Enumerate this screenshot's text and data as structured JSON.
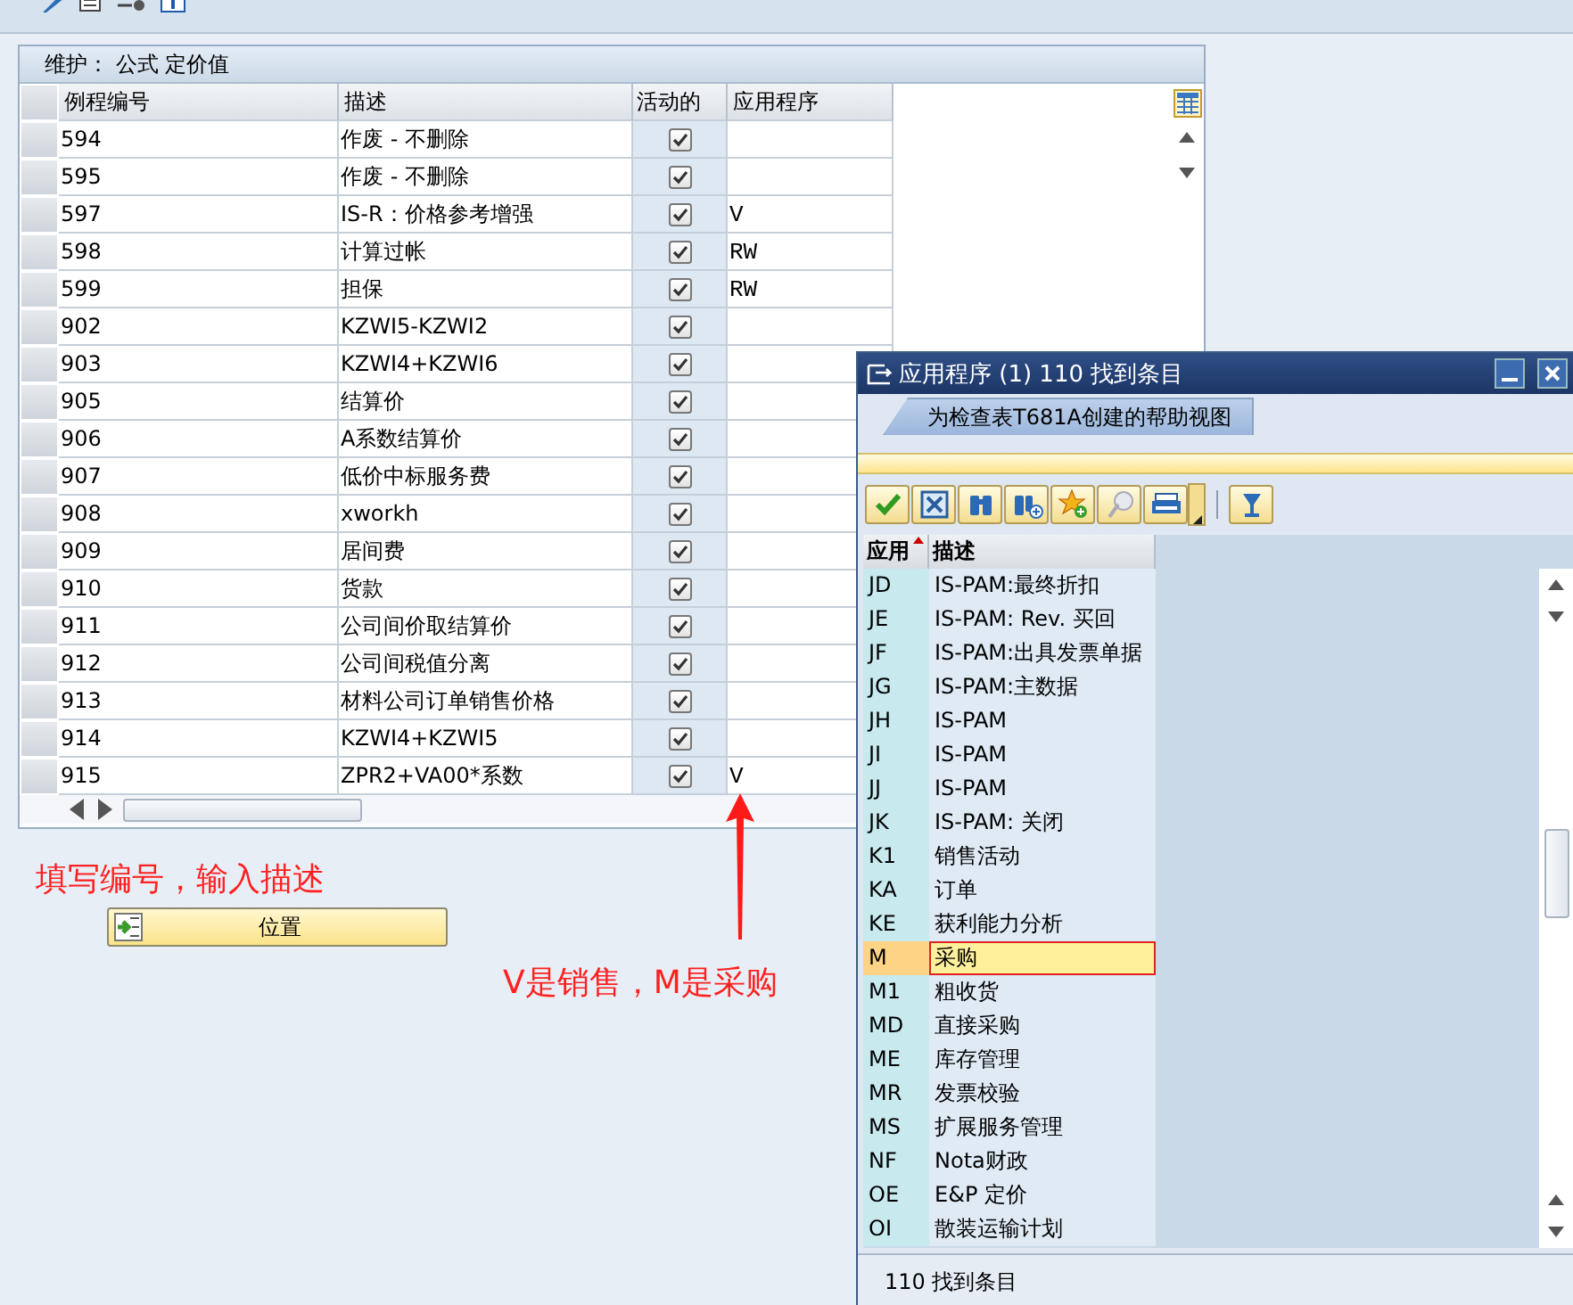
{
  "panel": {
    "title": "维护： 公式 定价值",
    "columns": [
      "例程编号",
      "描述",
      "活动的",
      "应用程序"
    ],
    "rows": [
      {
        "number": "594",
        "description": "作废 - 不删除",
        "active": true,
        "application": ""
      },
      {
        "number": "595",
        "description": "作废 - 不删除",
        "active": true,
        "application": ""
      },
      {
        "number": "597",
        "description": "IS-R：价格参考增强",
        "active": true,
        "application": "V"
      },
      {
        "number": "598",
        "description": "计算过帐",
        "active": true,
        "application": "RW"
      },
      {
        "number": "599",
        "description": "担保",
        "active": true,
        "application": "RW"
      },
      {
        "number": "902",
        "description": "KZWI5-KZWI2",
        "active": true,
        "application": ""
      },
      {
        "number": "903",
        "description": "KZWI4+KZWI6",
        "active": true,
        "application": ""
      },
      {
        "number": "905",
        "description": "结算价",
        "active": true,
        "application": ""
      },
      {
        "number": "906",
        "description": "A系数结算价",
        "active": true,
        "application": ""
      },
      {
        "number": "907",
        "description": "低价中标服务费",
        "active": true,
        "application": ""
      },
      {
        "number": "908",
        "description": "xworkh",
        "active": true,
        "application": ""
      },
      {
        "number": "909",
        "description": "居间费",
        "active": true,
        "application": ""
      },
      {
        "number": "910",
        "description": "货款",
        "active": true,
        "application": ""
      },
      {
        "number": "911",
        "description": "公司间价取结算价",
        "active": true,
        "application": ""
      },
      {
        "number": "912",
        "description": "公司间税值分离",
        "active": true,
        "application": ""
      },
      {
        "number": "913",
        "description": "材料公司订单销售价格",
        "active": true,
        "application": ""
      },
      {
        "number": "914",
        "description": "KZWI4+KZWI5",
        "active": true,
        "application": ""
      },
      {
        "number": "915",
        "description": "ZPR2+VA00*系数",
        "active": true,
        "application": "V"
      }
    ]
  },
  "position_button": "位置",
  "annotations": [
    "填写编号，输入描述",
    "V是销售，M是采购"
  ],
  "popup": {
    "title": "应用程序 (1) 110 找到条目",
    "tab": {
      "label": "为检查表T681A创建的帮助视图",
      "selected": true
    },
    "columns": [
      "应用",
      "描述"
    ],
    "rows": [
      {
        "code": "JD",
        "description": "IS-PAM:最终折扣",
        "selected": false
      },
      {
        "code": "JE",
        "description": "IS-PAM: Rev. 买回",
        "selected": false
      },
      {
        "code": "JF",
        "description": "IS-PAM:出具发票单据",
        "selected": false
      },
      {
        "code": "JG",
        "description": "IS-PAM:主数据",
        "selected": false
      },
      {
        "code": "JH",
        "description": "IS-PAM",
        "selected": false
      },
      {
        "code": "JI",
        "description": "IS-PAM",
        "selected": false
      },
      {
        "code": "JJ",
        "description": "IS-PAM",
        "selected": false
      },
      {
        "code": "JK",
        "description": "IS-PAM: 关闭",
        "selected": false
      },
      {
        "code": "K1",
        "description": "销售活动",
        "selected": false
      },
      {
        "code": "KA",
        "description": "订单",
        "selected": false
      },
      {
        "code": "KE",
        "description": "获利能力分析",
        "selected": false
      },
      {
        "code": "M",
        "description": "采购",
        "selected": true
      },
      {
        "code": "M1",
        "description": "粗收货",
        "selected": false
      },
      {
        "code": "MD",
        "description": "直接采购",
        "selected": false
      },
      {
        "code": "ME",
        "description": "库存管理",
        "selected": false
      },
      {
        "code": "MR",
        "description": "发票校验",
        "selected": false
      },
      {
        "code": "MS",
        "description": "扩展服务管理",
        "selected": false
      },
      {
        "code": "NF",
        "description": "Nota财政",
        "selected": false
      },
      {
        "code": "OE",
        "description": "E&P 定价",
        "selected": false
      },
      {
        "code": "OI",
        "description": "散装运输计划",
        "selected": false
      }
    ],
    "status": "110 找到条目"
  }
}
